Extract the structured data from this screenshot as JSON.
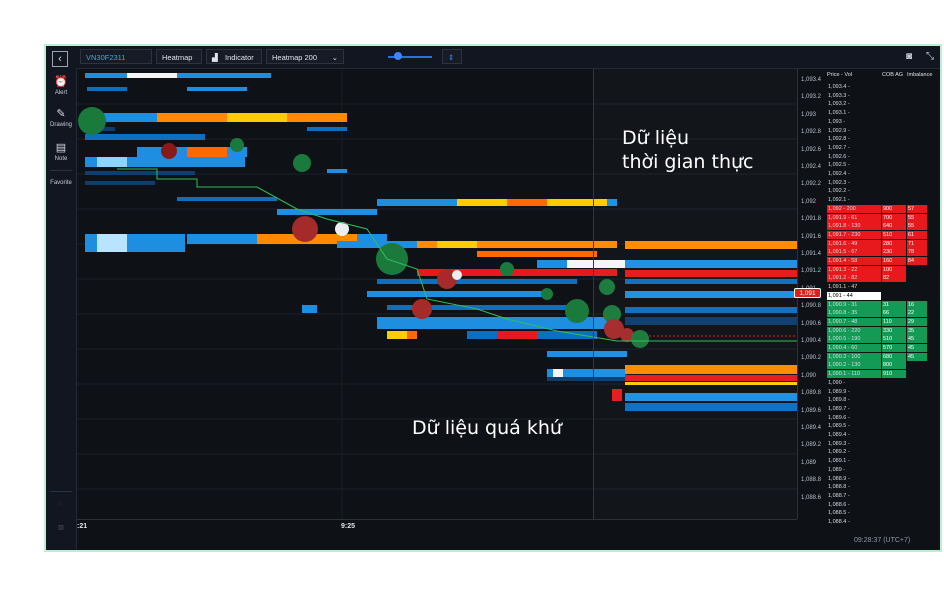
{
  "toolbar": {
    "symbol": "VN30F2311",
    "heatmap_label": "Heatmap",
    "indicator_label": "Indicator",
    "heatmap_select": "Heatmap 200"
  },
  "sidebar": {
    "collapse_icon": "chevron-left-icon",
    "items": [
      {
        "label": "Alert",
        "icon": "clock-icon"
      },
      {
        "label": "Drawing",
        "icon": "pen-icon"
      },
      {
        "label": "Note",
        "icon": "note-icon"
      },
      {
        "label": "Favorite",
        "icon": "star-icon"
      }
    ]
  },
  "overlay": {
    "realtime_line1": "Dữ liệu",
    "realtime_line2": "thời gian thực",
    "history": "Dữ liệu quá khứ"
  },
  "time_axis": {
    "labels": [
      ":21",
      "9:25"
    ]
  },
  "price_axis": {
    "ticks": [
      "1,093.4",
      "1,093.2",
      "1,093",
      "1,092.8",
      "1,092.6",
      "1,092.4",
      "1,092.2",
      "1,092",
      "1,091.8",
      "1,091.6",
      "1,091.4",
      "1,091.2",
      "1,091",
      "1,090.8",
      "1,090.6",
      "1,090.4",
      "1,090.2",
      "1,090",
      "1,089.8",
      "1,089.6",
      "1,089.4",
      "1,089.2",
      "1,089",
      "1,088.8",
      "1,088.6"
    ],
    "current_price": "1,091"
  },
  "ladder": {
    "header_price": "Price - Vol",
    "header_cob": "COB AG",
    "header_imb": "Imbalance",
    "rows": [
      {
        "p": "1,093.4 -",
        "c": "",
        "i": "",
        "s": ""
      },
      {
        "p": "1,093.3 -",
        "c": "",
        "i": "",
        "s": ""
      },
      {
        "p": "1,093.2 -",
        "c": "",
        "i": "",
        "s": ""
      },
      {
        "p": "1,093.1 -",
        "c": "",
        "i": "",
        "s": ""
      },
      {
        "p": "1,093 -",
        "c": "",
        "i": "",
        "s": ""
      },
      {
        "p": "1,092.9 -",
        "c": "",
        "i": "",
        "s": ""
      },
      {
        "p": "1,092.8 -",
        "c": "",
        "i": "",
        "s": ""
      },
      {
        "p": "1,092.7 -",
        "c": "",
        "i": "",
        "s": ""
      },
      {
        "p": "1,092.6 -",
        "c": "",
        "i": "",
        "s": ""
      },
      {
        "p": "1,092.5 -",
        "c": "",
        "i": "",
        "s": ""
      },
      {
        "p": "1,092.4 -",
        "c": "",
        "i": "",
        "s": ""
      },
      {
        "p": "1,092.3 -",
        "c": "",
        "i": "",
        "s": ""
      },
      {
        "p": "1,092.2 -",
        "c": "",
        "i": "",
        "s": ""
      },
      {
        "p": "1,092.1 -",
        "c": "",
        "i": "",
        "s": ""
      },
      {
        "p": "1,092 - 200",
        "c": "900",
        "i": "57",
        "s": "ask"
      },
      {
        "p": "1,091.9 - 61",
        "c": "700",
        "i": "55",
        "s": "ask"
      },
      {
        "p": "1,091.8 - 130",
        "c": "640",
        "i": "55",
        "s": "ask"
      },
      {
        "p": "1,091.7 - 230",
        "c": "510",
        "i": "61",
        "s": "ask"
      },
      {
        "p": "1,091.6 - 49",
        "c": "280",
        "i": "71",
        "s": "ask"
      },
      {
        "p": "1,091.5 - 67",
        "c": "230",
        "i": "78",
        "s": "ask"
      },
      {
        "p": "1,091.4 - 58",
        "c": "160",
        "i": "84",
        "s": "ask"
      },
      {
        "p": "1,091.3 - 22",
        "c": "100",
        "i": "",
        "s": "ask"
      },
      {
        "p": "1,091.2 - 82",
        "c": "82",
        "i": "",
        "s": "ask"
      },
      {
        "p": "1,091.1 - 47",
        "c": "",
        "i": "",
        "s": ""
      },
      {
        "p": "1,091 - 44",
        "c": "",
        "i": "",
        "s": "mid"
      },
      {
        "p": "1,090.9 - 31",
        "c": "31",
        "i": "16",
        "s": "bid"
      },
      {
        "p": "1,090.8 - 35",
        "c": "66",
        "i": "22",
        "s": "bid"
      },
      {
        "p": "1,090.7 - 48",
        "c": "110",
        "i": "29",
        "s": "bid"
      },
      {
        "p": "1,090.6 - 220",
        "c": "330",
        "i": "35",
        "s": "bid"
      },
      {
        "p": "1,090.5 - 190",
        "c": "510",
        "i": "45",
        "s": "bid"
      },
      {
        "p": "1,090.4 - 60",
        "c": "570",
        "i": "45",
        "s": "bid"
      },
      {
        "p": "1,090.3 - 100",
        "c": "680",
        "i": "45",
        "s": "bid"
      },
      {
        "p": "1,090.2 - 130",
        "c": "800",
        "i": "",
        "s": "bid"
      },
      {
        "p": "1,090.1 - 110",
        "c": "910",
        "i": "",
        "s": "bid"
      },
      {
        "p": "1,090 -",
        "c": "",
        "i": "",
        "s": ""
      },
      {
        "p": "1,089.9 -",
        "c": "",
        "i": "",
        "s": ""
      },
      {
        "p": "1,089.8 -",
        "c": "",
        "i": "",
        "s": ""
      },
      {
        "p": "1,089.7 -",
        "c": "",
        "i": "",
        "s": ""
      },
      {
        "p": "1,089.6 -",
        "c": "",
        "i": "",
        "s": ""
      },
      {
        "p": "1,089.5 -",
        "c": "",
        "i": "",
        "s": ""
      },
      {
        "p": "1,089.4 -",
        "c": "",
        "i": "",
        "s": ""
      },
      {
        "p": "1,089.3 -",
        "c": "",
        "i": "",
        "s": ""
      },
      {
        "p": "1,089.2 -",
        "c": "",
        "i": "",
        "s": ""
      },
      {
        "p": "1,089.1 -",
        "c": "",
        "i": "",
        "s": ""
      },
      {
        "p": "1,089 -",
        "c": "",
        "i": "",
        "s": ""
      },
      {
        "p": "1,088.9 -",
        "c": "",
        "i": "",
        "s": ""
      },
      {
        "p": "1,088.8 -",
        "c": "",
        "i": "",
        "s": ""
      },
      {
        "p": "1,088.7 -",
        "c": "",
        "i": "",
        "s": ""
      },
      {
        "p": "1,088.6 -",
        "c": "",
        "i": "",
        "s": ""
      },
      {
        "p": "1,088.5 -",
        "c": "",
        "i": "",
        "s": ""
      },
      {
        "p": "1,088.4 -",
        "c": "",
        "i": "",
        "s": ""
      }
    ]
  },
  "clock": "09:28:37 (UTC+7)",
  "colors": {
    "ask": "#e8191c",
    "bid": "#139a55",
    "accent": "#3d86ff",
    "heat_high": "#ff8a00",
    "heat_mid": "#1e8fe0",
    "heat_low": "#0d3e6e"
  }
}
